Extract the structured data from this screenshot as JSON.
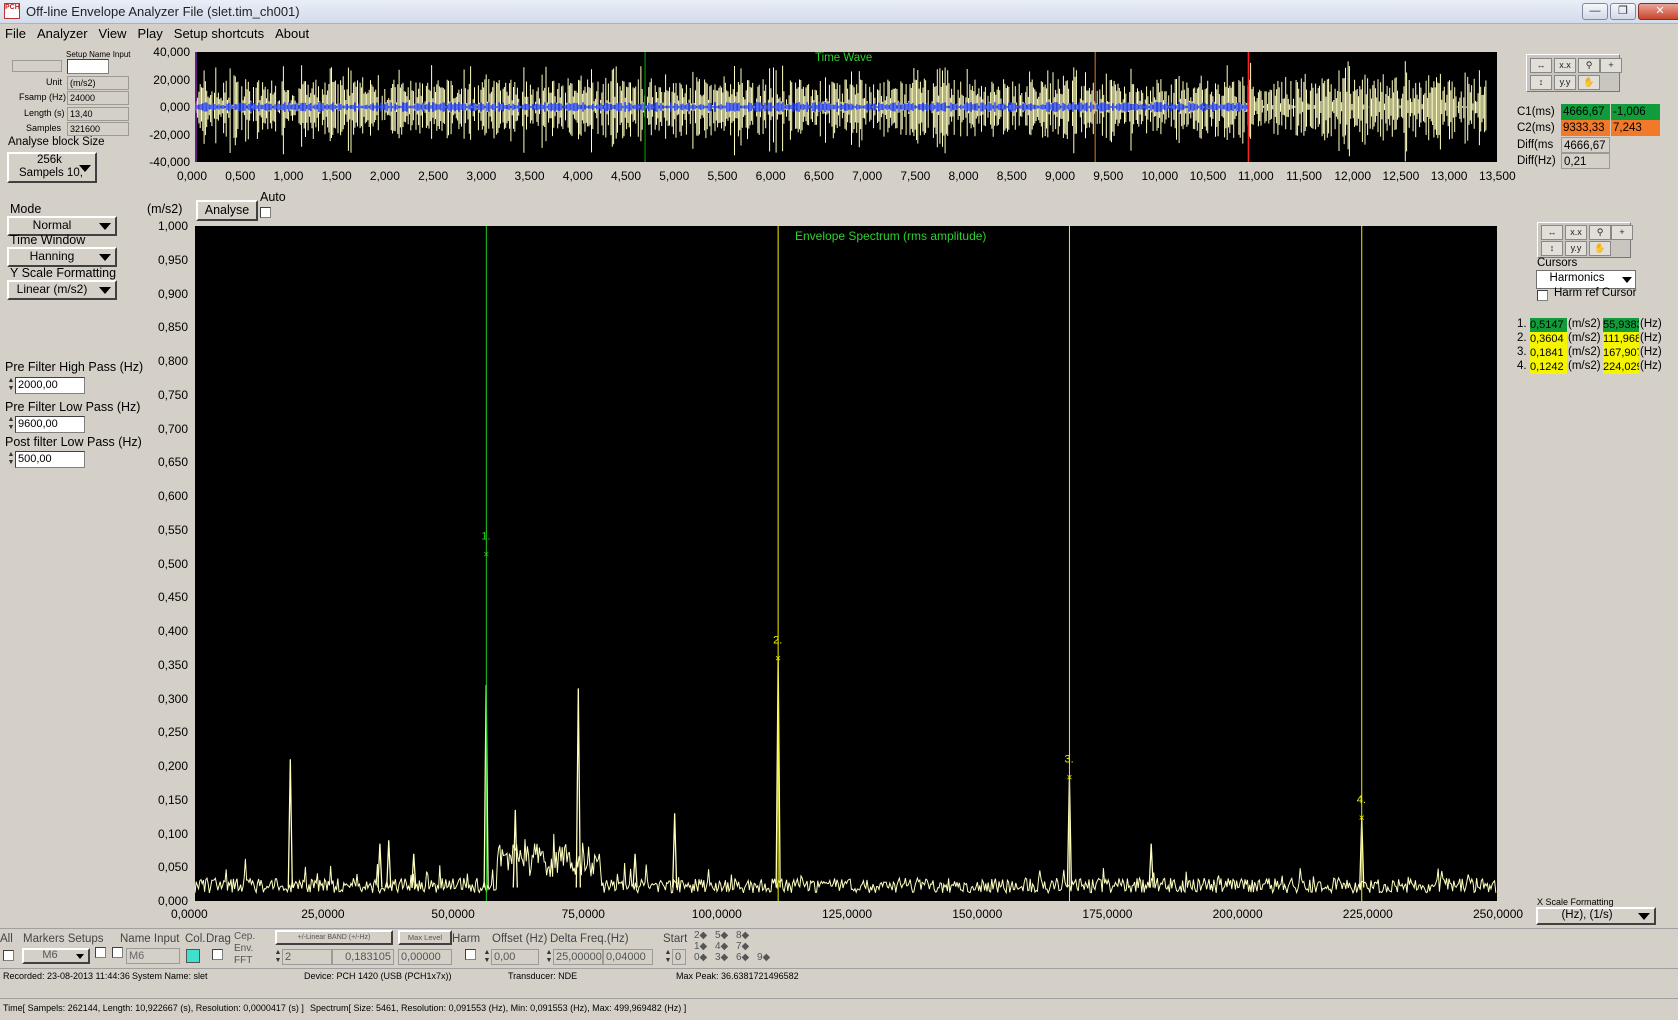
{
  "window": {
    "app_icon": "PCH",
    "title": "Off-line Envelope Analyzer  File (slet.tim_ch001)"
  },
  "menu": [
    "File",
    "Analyzer",
    "View",
    "Play",
    "Setup shortcuts",
    "About"
  ],
  "setup_panel": {
    "setup_name_label": "Setup Name Input",
    "setup_name_value": "",
    "unit_label": "Unit",
    "unit_value": "(m/s2)",
    "fsamp_label": "Fsamp (Hz)",
    "fsamp_value": "24000",
    "length_label": "Length (s)",
    "length_value": "13,40",
    "samples_label": "Samples",
    "samples_value": "321600",
    "analyse_block_label": "Analyse block Size",
    "analyse_block_value_line1": "256k",
    "analyse_block_value_line2": "Sampels 10,"
  },
  "time_wave": {
    "title": "Time Wave",
    "y_ticks": [
      "40,000",
      "20,000",
      "0,000",
      "-20,000",
      "-40,000"
    ],
    "x_ticks": [
      "0,000",
      "0,500",
      "1,000",
      "1,500",
      "2,000",
      "2,500",
      "3,000",
      "3,500",
      "4,000",
      "4,500",
      "5,000",
      "5,500",
      "6,000",
      "6,500",
      "7,000",
      "7,500",
      "8,000",
      "8,500",
      "9,000",
      "9,500",
      "10,000",
      "10,500",
      "11,000",
      "11,500",
      "12,000",
      "12,500",
      "13,000",
      "13,500"
    ],
    "x_max": 13.5,
    "analysed_until": 10.9227,
    "cursor_green_at": 4.66667,
    "cursor_orange_at": 9.33333,
    "cursor_red_at": 10.9227,
    "colors": {
      "signal": "#ffffc0",
      "analysed": "#1f3cff",
      "c1": "#00b000",
      "c2": "#e07a2a",
      "end": "#ff2020"
    }
  },
  "time_cursors": {
    "c1_label": "C1(ms)",
    "c1_value": "4666,67",
    "c1_amp": "-1,006",
    "c2_label": "C2(ms)",
    "c2_value": "9333,33",
    "c2_amp": "7,243",
    "diff_ms_label": "Diff(ms",
    "diff_ms_value": "4666,67",
    "diff_hz_label": "Diff(Hz)",
    "diff_hz_value": "0,21"
  },
  "controls": {
    "mode_label": "Mode",
    "mode_value": "Normal",
    "time_window_label": "Time Window",
    "time_window_value": "Hanning",
    "y_scale_label": "Y Scale Formatting",
    "y_scale_value": "Linear (m/s2)",
    "hp_label": "Pre Filter High Pass (Hz)",
    "hp_value": "2000,00",
    "lp_label": "Pre Filter Low Pass (Hz)",
    "lp_value": "9600,00",
    "post_label": "Post filter Low Pass (Hz)",
    "post_value": "500,00",
    "unit_axis": "(m/s2)",
    "analyse_button": "Analyse",
    "auto_label": "Auto"
  },
  "spectrum": {
    "title": "Envelope Spectrum (rms amplitude)",
    "y_ticks": [
      "1,000",
      "0,950",
      "0,900",
      "0,850",
      "0,800",
      "0,750",
      "0,700",
      "0,650",
      "0,600",
      "0,550",
      "0,500",
      "0,450",
      "0,400",
      "0,350",
      "0,300",
      "0,250",
      "0,200",
      "0,150",
      "0,100",
      "0,050",
      "0,000"
    ],
    "x_ticks": [
      "0,0000",
      "25,0000",
      "50,0000",
      "75,0000",
      "100,0000",
      "125,0000",
      "150,0000",
      "175,0000",
      "200,0000",
      "225,0000",
      "250,0000"
    ],
    "x_max": 250,
    "y_max": 1.0,
    "trace_color": "#ffffc0",
    "peaks": [
      {
        "x": 18.3,
        "y": 0.21
      },
      {
        "x": 35.5,
        "y": 0.085
      },
      {
        "x": 37.2,
        "y": 0.09
      },
      {
        "x": 42,
        "y": 0.07
      },
      {
        "x": 55.9,
        "y": 0.32
      },
      {
        "x": 61.5,
        "y": 0.135
      },
      {
        "x": 73.6,
        "y": 0.315
      },
      {
        "x": 84.5,
        "y": 0.07
      },
      {
        "x": 92.1,
        "y": 0.13
      },
      {
        "x": 111.97,
        "y": 0.36
      },
      {
        "x": 167.9,
        "y": 0.184
      },
      {
        "x": 183.6,
        "y": 0.085
      },
      {
        "x": 224.03,
        "y": 0.124
      }
    ],
    "markers": [
      {
        "label": "1.",
        "x": 55.938,
        "y": 0.5147,
        "color": "#20d020"
      },
      {
        "label": "2.",
        "x": 111.968,
        "y": 0.3604,
        "color": "#f0f000"
      },
      {
        "label": "3.",
        "x": 167.907,
        "y": 0.1841,
        "color": "#f0f000"
      },
      {
        "label": "4.",
        "x": 224.029,
        "y": 0.1242,
        "color": "#f0f000"
      }
    ],
    "x_scale_label": "X Scale Formatting",
    "x_scale_value": "(Hz), (1/s)"
  },
  "cursor_panel": {
    "cursors_label": "Cursors",
    "cursors_value": "Harmonics",
    "harm_ref_label": "Harm ref Cursor",
    "rows": [
      {
        "n": "1.",
        "amp": "0,5147",
        "amp_unit": "(m/s2)",
        "freq": "55,9383",
        "freq_unit": "(Hz)",
        "color": "#119c3b"
      },
      {
        "n": "2.",
        "amp": "0,3604",
        "amp_unit": "(m/s2)",
        "freq": "111,968",
        "freq_unit": "(Hz)",
        "color": "#f5f500"
      },
      {
        "n": "3.",
        "amp": "0,1841",
        "amp_unit": "(m/s2)",
        "freq": "167,907",
        "freq_unit": "(Hz)",
        "color": "#f5f500"
      },
      {
        "n": "4.",
        "amp": "0,1242",
        "amp_unit": "(m/s2)",
        "freq": "224,029",
        "freq_unit": "(Hz)",
        "color": "#f5f500"
      }
    ]
  },
  "bottom_panel": {
    "all_label": "All",
    "markers_setups_label": "Markers Setups",
    "markers_value": "M6",
    "name_input_label": "Name Input",
    "name_input_value": "M6",
    "col_label": "Col.",
    "drag_label": "Drag",
    "cep_label": "Cep.",
    "env_label": "Env.",
    "fft_label": "FFT",
    "band_button": "+/-Linear BAND (+/-Hz)",
    "band_count": "2",
    "band_value": "0,183105",
    "max_level_button": "Max Level",
    "max_level_value": "0,00000",
    "harm_label": "Harm",
    "offset_label": "Offset (Hz)",
    "offset_value": "0,00",
    "delta_label": "Delta Freq.(Hz)",
    "delta_value": "25,00000",
    "delta_value2": "0,04000",
    "start_label": "Start",
    "start_value": "0",
    "harm_numbers": [
      "2",
      "5",
      "8",
      "1",
      "4",
      "7",
      "0",
      "3",
      "6",
      "9"
    ]
  },
  "status": {
    "recorded": "Recorded: 23-08-2013 11:44:36",
    "system": "System Name: slet",
    "device": "Device: PCH 1420 (USB  (PCH1x7x))",
    "transducer": "Transducer: NDE",
    "max_peak": "Max Peak: 36.6381721496582",
    "time_info": "Time[ Sampels: 262144,  Length: 10,922667 (s),  Resolution: 0,0000417 (s) ]",
    "spectrum_info": "Spectrum[ Size: 5461,  Resolution: 0,091553  (Hz),  Min: 0,091553  (Hz),  Max: 499,969482 (Hz) ]"
  }
}
